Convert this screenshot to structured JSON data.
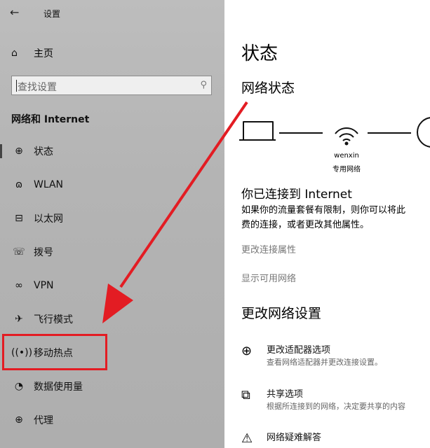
{
  "window": {
    "title": "设置",
    "back_glyph": "←"
  },
  "sidebar": {
    "home_label": "主页",
    "search_placeholder": "查找设置",
    "section_title": "网络和 Internet",
    "items": [
      {
        "label": "状态",
        "icon": "globe-icon",
        "active": true
      },
      {
        "label": "WLAN",
        "icon": "wifi-icon"
      },
      {
        "label": "以太网",
        "icon": "ethernet-icon"
      },
      {
        "label": "拨号",
        "icon": "dialup-icon"
      },
      {
        "label": "VPN",
        "icon": "vpn-icon"
      },
      {
        "label": "飞行模式",
        "icon": "airplane-icon"
      },
      {
        "label": "移动热点",
        "icon": "hotspot-icon",
        "highlighted": true
      },
      {
        "label": "数据使用量",
        "icon": "data-usage-icon"
      },
      {
        "label": "代理",
        "icon": "proxy-icon"
      }
    ]
  },
  "main": {
    "page_title": "状态",
    "network_status_heading": "网络状态",
    "network": {
      "name": "wenxin",
      "type": "专用网络"
    },
    "connected_title": "你已连接到 Internet",
    "connected_desc": "如果你的流量套餐有限制，则你可以将此\n费的连接，或者更改其他属性。",
    "link_change_props": "更改连接属性",
    "link_show_networks": "显示可用网络",
    "change_settings_heading": "更改网络设置",
    "options": [
      {
        "title": "更改适配器选项",
        "desc": "查看网络适配器并更改连接设置。",
        "icon": "adapter-icon"
      },
      {
        "title": "共享选项",
        "desc": "根据所连接到的网络，决定要共享的内容",
        "icon": "sharing-icon"
      },
      {
        "title": "网络疑难解答",
        "desc": "",
        "icon": "troubleshoot-icon"
      }
    ]
  },
  "annotation": {
    "color": "#e31c23"
  }
}
